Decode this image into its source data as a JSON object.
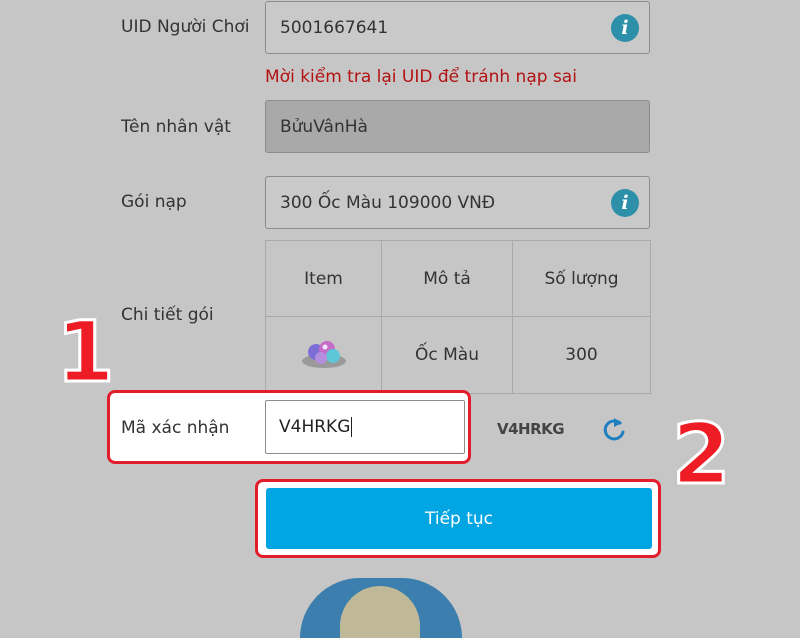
{
  "form": {
    "uid_label": "UID Người Chơi",
    "uid_value": "5001667641",
    "uid_warning": "Mời kiểm tra lại UID để tránh nạp sai",
    "character_label": "Tên nhân vật",
    "character_value": "BửuVânHà",
    "package_label": "Gói nạp",
    "package_value": "300 Ốc Màu 109000 VNĐ",
    "detail_label": "Chi tiết gói",
    "info_icon": "i",
    "table": {
      "headers": [
        "Item",
        "Mô tả",
        "Số lượng"
      ],
      "row": {
        "item_icon": "gem-item-icon",
        "description": "Ốc Màu",
        "quantity": "300"
      }
    },
    "captcha_label": "Mã xác nhận",
    "captcha_value": "V4HRKG",
    "captcha_image_text": "V4HRKG",
    "submit_label": "Tiếp tục"
  },
  "annotations": {
    "step1": "1",
    "step2": "2",
    "highlight_color": "#e21d2c"
  },
  "colors": {
    "button": "#00a5e2",
    "warning": "#b31212",
    "info_icon": "#2e8fa8"
  }
}
